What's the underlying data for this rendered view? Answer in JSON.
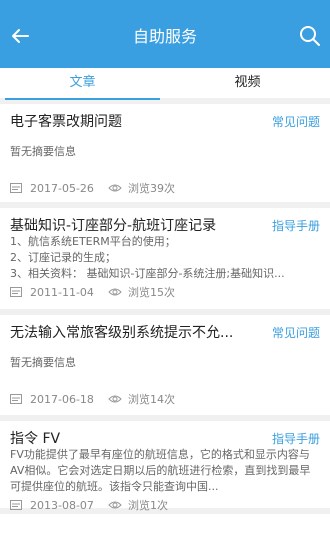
{
  "header": {
    "title": "自助服务",
    "back_icon": "back-arrow-icon",
    "search_icon": "search-icon",
    "bg_color": "#3a9fe0"
  },
  "tabs": [
    {
      "label": "文章",
      "active": true
    },
    {
      "label": "视频",
      "active": false
    }
  ],
  "items": [
    {
      "title": "电子客票改期问题",
      "category": "常见问题",
      "summary": [
        "暂无摘要信息"
      ],
      "date": "2017-05-26",
      "views": "浏览39次"
    },
    {
      "title": "基础知识-订座部分-航班订座记录",
      "category": "指导手册",
      "summary": [
        "1、航信系统ETERM平台的使用；",
        "2、订座记录的生成；",
        "3、相关资料：  基础知识-订座部分-系统注册;基础知识..."
      ],
      "date": "2011-11-04",
      "views": "浏览15次"
    },
    {
      "title": "无法输入常旅客级别系统提示不允...",
      "category": "常见问题",
      "summary": [
        "暂无摘要信息"
      ],
      "date": "2017-06-18",
      "views": "浏览14次"
    },
    {
      "title": "指令 FV",
      "category": "指导手册",
      "summary": [
        "FV功能提供了最早有座位的航班信息，它的格式和显示内容与AV相似。它会对选定日期以后的航班进行检索，直到找到最早可提供座位的航班。该指令只能查询中国..."
      ],
      "date": "2013-08-07",
      "views": "浏览1次"
    }
  ]
}
